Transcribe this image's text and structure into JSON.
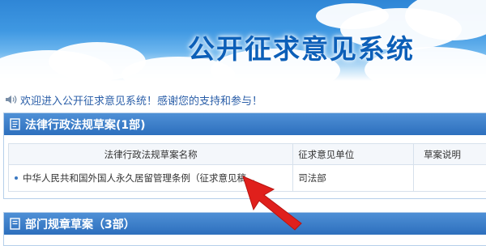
{
  "banner": {
    "title": "公开征求意见系统"
  },
  "welcome": {
    "text": "欢迎进入公开征求意见系统！感谢您的支持和参与！",
    "icon": "speaker-icon"
  },
  "sections": [
    {
      "title": "法律行政法规草案(1部)",
      "columns": [
        "法律行政法规草案名称",
        "征求意见单位",
        "草案说明"
      ],
      "rows": [
        {
          "name": "中华人民共和国外国人永久居留管理条例（征求意见稿...",
          "unit": "司法部",
          "note": ""
        }
      ]
    },
    {
      "title": "部门规章草案（3部）"
    }
  ],
  "colors": {
    "header_blue": "#2d6fbd",
    "title_blue": "#0c5fb8",
    "arrow_red": "#e0201c"
  }
}
